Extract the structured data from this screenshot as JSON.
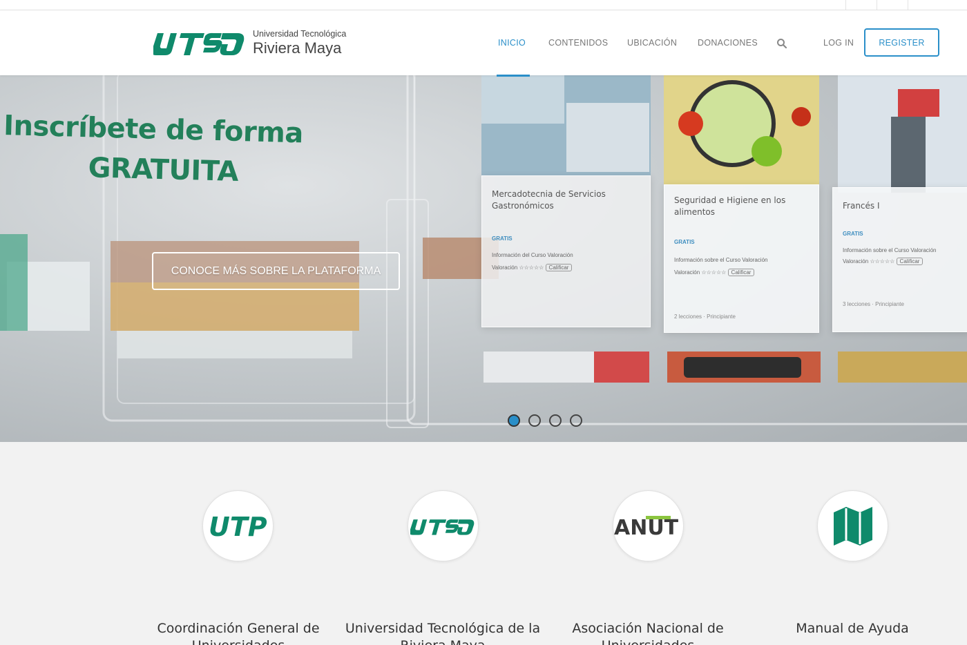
{
  "brand": {
    "name_small": "Universidad Tecnológica",
    "name_large": "Riviera Maya",
    "accent_color": "#2a8fc9",
    "green_color": "#0f8a6b"
  },
  "nav": {
    "items": [
      "INICIO",
      "CONTENIDOS",
      "UBICACIÓN",
      "DONACIONES"
    ],
    "active": "INICIO",
    "search_icon": "search-icon",
    "login_label": "LOG IN",
    "register_label": "REGISTER"
  },
  "hero": {
    "headline_line1": "Inscríbete de forma",
    "headline_line2": "GRATUITA",
    "cta_label": "CONOCE MÁS SOBRE LA PLATAFORMA",
    "cards": [
      {
        "title": "Mercadotecnia de Servicios Gastronómicos",
        "badge": "GRATIS",
        "info": "Información del Curso Valoración",
        "rating_label": "Valoración",
        "rate_button": "Calificar",
        "lessons": "",
        "status": ""
      },
      {
        "title": "Seguridad e Higiene en los alimentos",
        "badge": "GRATIS",
        "info": "Información sobre el Curso Valoración",
        "rating_label": "Valoración",
        "rate_button": "Calificar",
        "lessons": "2 lecciones",
        "status": "Principiante"
      },
      {
        "title": "Francés I",
        "badge": "GRATIS",
        "info": "Información sobre el Curso Valoración",
        "rating_label": "Valoración",
        "rate_button": "Calificar",
        "lessons": "3 lecciones",
        "status": "Principiante"
      }
    ],
    "slide_count": 4,
    "active_slide": 1
  },
  "features": [
    {
      "icon": "utp-logo-icon",
      "icon_text": "UTP",
      "title": "Coordinación General de Universidades"
    },
    {
      "icon": "utrm-logo-icon",
      "icon_text": "",
      "title": "Universidad Tecnológica de la Riviera Maya"
    },
    {
      "icon": "anut-logo-icon",
      "icon_text": "ANUT",
      "title": "Asociación Nacional de Universidades"
    },
    {
      "icon": "map-icon",
      "icon_text": "",
      "title": "Manual de Ayuda"
    }
  ]
}
